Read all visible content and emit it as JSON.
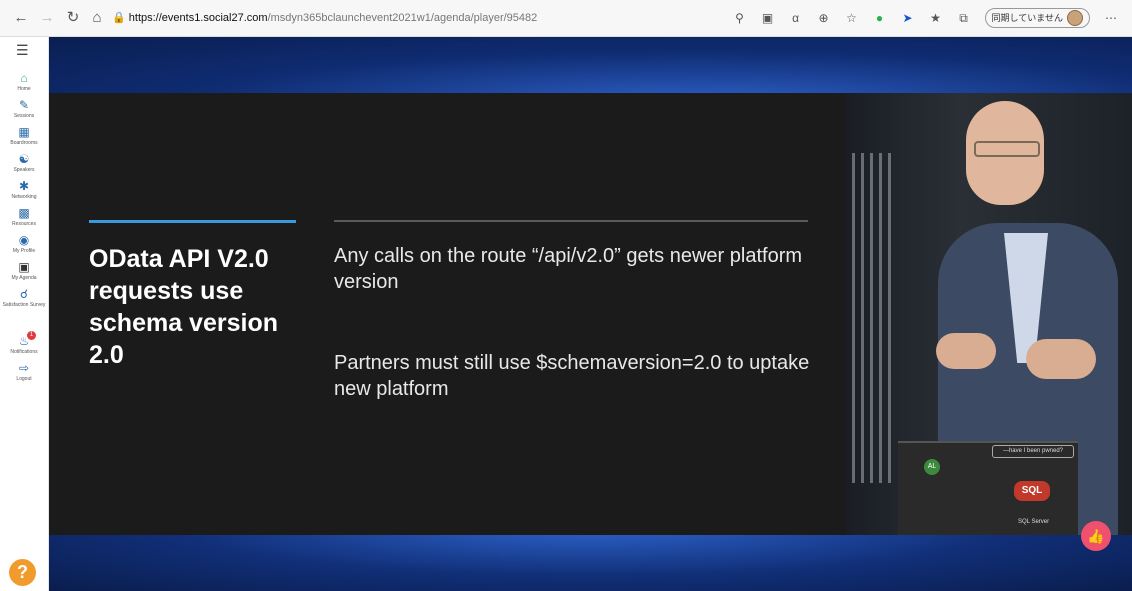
{
  "browser": {
    "url_host": "https://events1.social27.com",
    "url_path": "/msdyn365bclaunchevent2021w1/agenda/player/95482",
    "sync_label": "同期していません"
  },
  "sidebar": {
    "items": [
      {
        "label": "Home",
        "icon": "home-icon"
      },
      {
        "label": "Sessions",
        "icon": "pen-icon"
      },
      {
        "label": "Boardrooms",
        "icon": "boardroom-icon"
      },
      {
        "label": "Speakers",
        "icon": "speaker-icon"
      },
      {
        "label": "Networking",
        "icon": "networking-icon"
      },
      {
        "label": "Resources",
        "icon": "resources-icon"
      },
      {
        "label": "My Profile",
        "icon": "profile-icon"
      },
      {
        "label": "My Agenda",
        "icon": "agenda-icon"
      },
      {
        "label": "Satisfaction Survey",
        "icon": "survey-icon"
      },
      {
        "label": "Notifications",
        "icon": "bell-icon",
        "badge": "1"
      },
      {
        "label": "Logout",
        "icon": "logout-icon"
      }
    ],
    "help_label": "?"
  },
  "slide": {
    "title": "OData API V2.0 requests use schema version 2.0",
    "bullets": [
      "Any calls on the route “/api/v2.0” gets newer platform version",
      "Partners must still use $schemaversion=2.0 to uptake new platform"
    ]
  },
  "video": {
    "stickers": {
      "sql": "SQL",
      "al": "AL",
      "pwned": "—have I been pwned?",
      "sql_server": "SQL Server"
    }
  },
  "colors": {
    "accent_line": "#3a9ad9",
    "slide_bg": "#1b1b1b",
    "like_button": "#f0506e",
    "help_button": "#f19b2c"
  }
}
